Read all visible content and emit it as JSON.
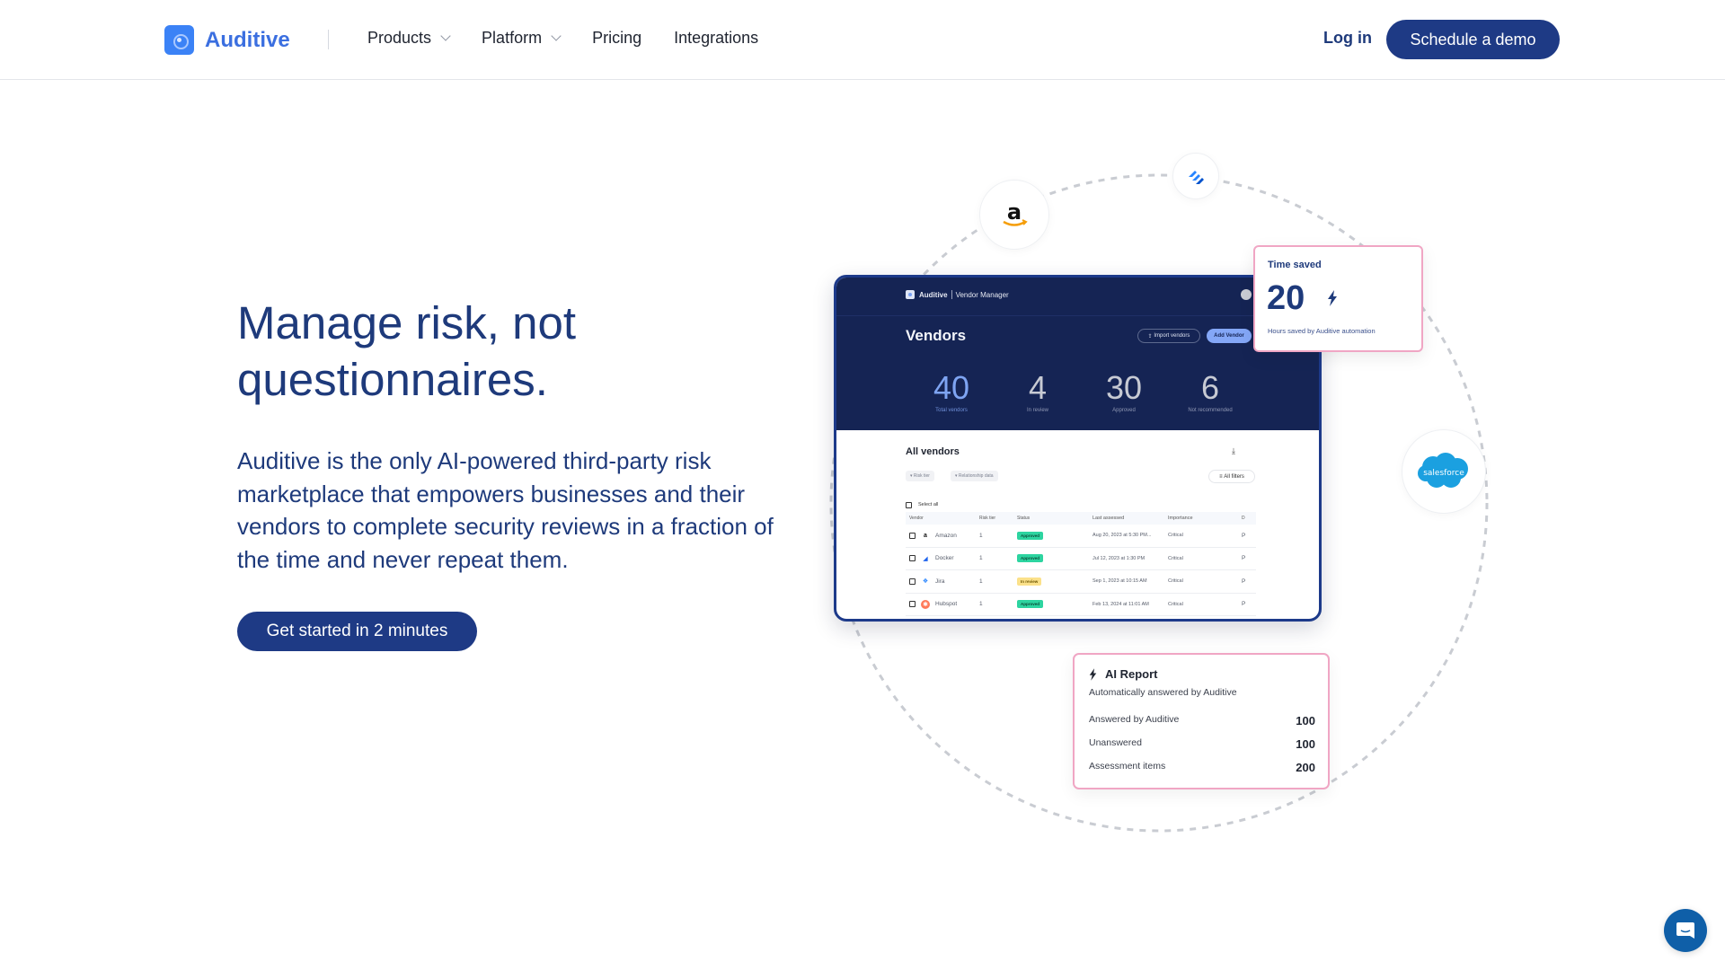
{
  "nav": {
    "brand": "Auditive",
    "links": [
      {
        "label": "Products",
        "has_dropdown": true
      },
      {
        "label": "Platform",
        "has_dropdown": true
      },
      {
        "label": "Pricing",
        "has_dropdown": false
      },
      {
        "label": "Integrations",
        "has_dropdown": false
      }
    ],
    "login": "Log in",
    "cta": "Schedule a demo"
  },
  "hero": {
    "title": "Manage risk, not questionnaires.",
    "description": "Auditive is the only AI-powered third-party risk marketplace that empowers businesses and their vendors to complete security reviews in a fraction of the time and never repeat them.",
    "cta": "Get started in 2 minutes"
  },
  "integrations": [
    "Amazon",
    "Jira",
    "Salesforce"
  ],
  "dashboard": {
    "brand": "Auditive",
    "module": "Vendor Manager",
    "title": "Vendors",
    "import_button": "Import vendors",
    "add_button": "Add Vendor",
    "stats": [
      {
        "value": "40",
        "label": "Total vendors"
      },
      {
        "value": "4",
        "label": "In review"
      },
      {
        "value": "30",
        "label": "Approved"
      },
      {
        "value": "6",
        "label": "Not recommended"
      }
    ],
    "list_title": "All vendors",
    "filters": [
      "Risk tier",
      "Relationship data"
    ],
    "all_filters": "All filters",
    "select_all": "Select all",
    "columns": [
      "Vendor",
      "Risk tier",
      "Status",
      "Last assessed",
      "Importance",
      "D"
    ],
    "rows": [
      {
        "vendor": "Amazon",
        "risk": "1",
        "status": "Approved",
        "last": "Aug 20, 2023 at 5:30 PM...",
        "importance": "Critical",
        "d": "P"
      },
      {
        "vendor": "Docker",
        "risk": "1",
        "status": "Approved",
        "last": "Jul 12, 2023 at 1:30 PM",
        "importance": "Critical",
        "d": "P"
      },
      {
        "vendor": "Jira",
        "risk": "1",
        "status": "In review",
        "last": "Sep 1, 2023 at 10:15 AM",
        "importance": "Critical",
        "d": "P"
      },
      {
        "vendor": "Hubspot",
        "risk": "1",
        "status": "Approved",
        "last": "Feb 13, 2024 at 11:01 AM",
        "importance": "Critical",
        "d": "P"
      }
    ]
  },
  "time_saved": {
    "title": "Time saved",
    "value": "20",
    "subtitle": "Hours saved by Auditive automation"
  },
  "ai_report": {
    "title": "AI Report",
    "subtitle": "Automatically answered by Auditive",
    "rows": [
      {
        "label": "Answered by Auditive",
        "value": "100"
      },
      {
        "label": "Unanswered",
        "value": "100"
      },
      {
        "label": "Assessment items",
        "value": "200"
      }
    ]
  },
  "colors": {
    "primary": "#1e3a85",
    "brand": "#3b82f6",
    "dashboard_bg": "#152454",
    "approved": "#2dd4a0",
    "in_review": "#fbe18a",
    "card_border": "#f0a6c4"
  }
}
